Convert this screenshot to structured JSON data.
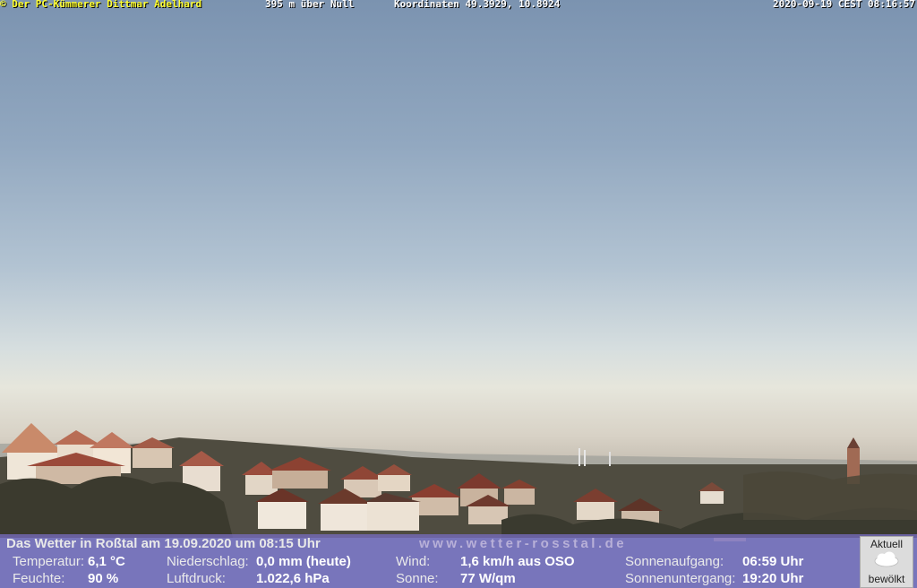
{
  "overlay": {
    "credit": "© Der PC-Kümmerer Dittmar Adelhard",
    "altitude": "395 m über Null",
    "coordinates": "Koordinaten 49.3929, 10.8924",
    "timestamp": "2020-09-19 CEST 08:16:57"
  },
  "weather": {
    "headline": "Das Wetter in Roßtal am 19.09.2020 um 08:15 Uhr",
    "website": "www.wetter-rosstal.de",
    "temperature_label": "Temperatur:",
    "temperature_value": "6,1 °C",
    "humidity_label": "Feuchte:",
    "humidity_value": "90 %",
    "precip_label": "Niederschlag:",
    "precip_value": "0,0 mm (heute)",
    "pressure_label": "Luftdruck:",
    "pressure_value": "1.022,6 hPa",
    "wind_label": "Wind:",
    "wind_value": "1,6 km/h aus OSO",
    "sun_label": "Sonne:",
    "sun_value": "77 W/qm",
    "sunrise_label": "Sonnenaufgang:",
    "sunrise_value": "06:59 Uhr",
    "sunset_label": "Sonnenuntergang:",
    "sunset_value": "19:20 Uhr"
  },
  "condition": {
    "title": "Aktuell",
    "status": "bewölkt",
    "icon": "cloud-icon"
  }
}
